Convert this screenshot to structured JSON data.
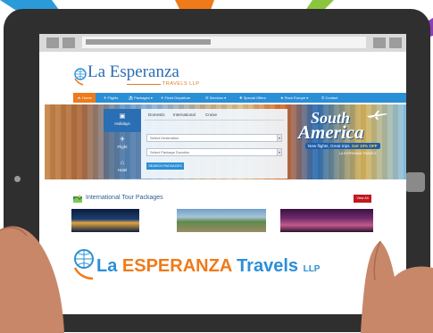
{
  "logo": {
    "name": "La Esperanza",
    "sub": "TRAVELS LLP"
  },
  "nav": {
    "items": [
      {
        "label": "🏠 Home"
      },
      {
        "label": "✈ Flights"
      },
      {
        "label": "⛱ Packages ▾"
      },
      {
        "label": "✈ Fixed Departure"
      },
      {
        "label": "☰ Services ▾"
      },
      {
        "label": "❖ Special Offers"
      },
      {
        "label": "★ Rove Europe ▾"
      },
      {
        "label": "✆ Contact"
      }
    ]
  },
  "search": {
    "side_tabs": [
      {
        "icon": "suitcase-icon",
        "glyph": "▣",
        "label": "Holidays"
      },
      {
        "icon": "plane-icon",
        "glyph": "✈",
        "label": "Flight"
      },
      {
        "icon": "hotel-icon",
        "glyph": "⌂",
        "label": "Hotel"
      }
    ],
    "tabs": [
      "Domestic",
      "International",
      "Cruise"
    ],
    "destination_select": "Select Destination",
    "duration_select": "Select Package Duration",
    "button_label": "SEARCH PACKAGES"
  },
  "promo": {
    "line1": "South",
    "line2": "America",
    "offer_prefix": "New flights, Great trips. ",
    "offer_highlight": "Get 10% OFF",
    "offer_suffix": "",
    "byline": "LA ESPERANZA TRAVELS"
  },
  "section": {
    "title": "International Tour Packages",
    "view_all": "View All"
  },
  "brand": {
    "part1": "La ",
    "part2": "ESPERANZA",
    "part3": " Travels",
    "suffix": "LLP"
  },
  "colors": {
    "nav_blue": "#2b8fd6",
    "accent_orange": "#f07a1a",
    "tablet_frame": "#2f2f2f",
    "view_all_red": "#c0181f"
  }
}
